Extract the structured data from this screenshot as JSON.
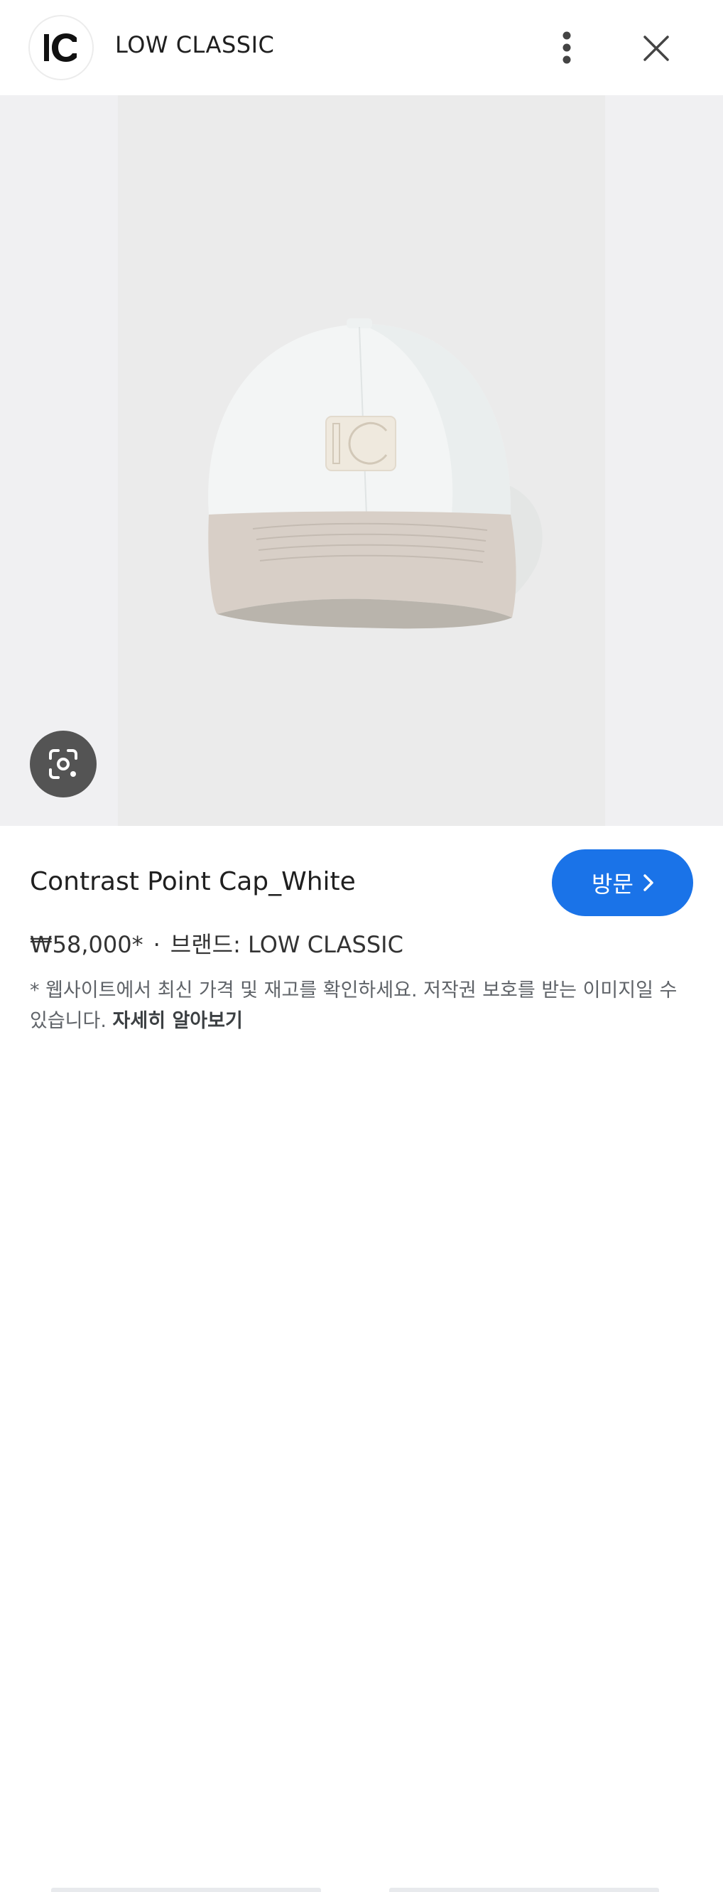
{
  "header": {
    "brand_name": "LOW CLASSIC",
    "logo_icon": "lc-logo-icon",
    "more_icon": "more-vert-icon",
    "close_icon": "close-icon"
  },
  "image": {
    "subject": "cap-image",
    "lens_icon": "google-lens-icon"
  },
  "product": {
    "title": "Contrast Point Cap_White",
    "price": "₩58,000*",
    "separator": "·",
    "brand_label": "브랜드: LOW CLASSIC",
    "visit_label": "방문",
    "visit_icon": "chevron-right-icon",
    "disclaimer": "* 웹사이트에서 최신 가격 및 재고를 확인하세요. 저작권 보호를 받는 이미지일 수 있습니다.",
    "learn_more": "자세히 알아보기"
  },
  "colors": {
    "accent": "#1a73e8",
    "image_bg": "#ebebeb",
    "page_bg": "#f0f0f2"
  }
}
